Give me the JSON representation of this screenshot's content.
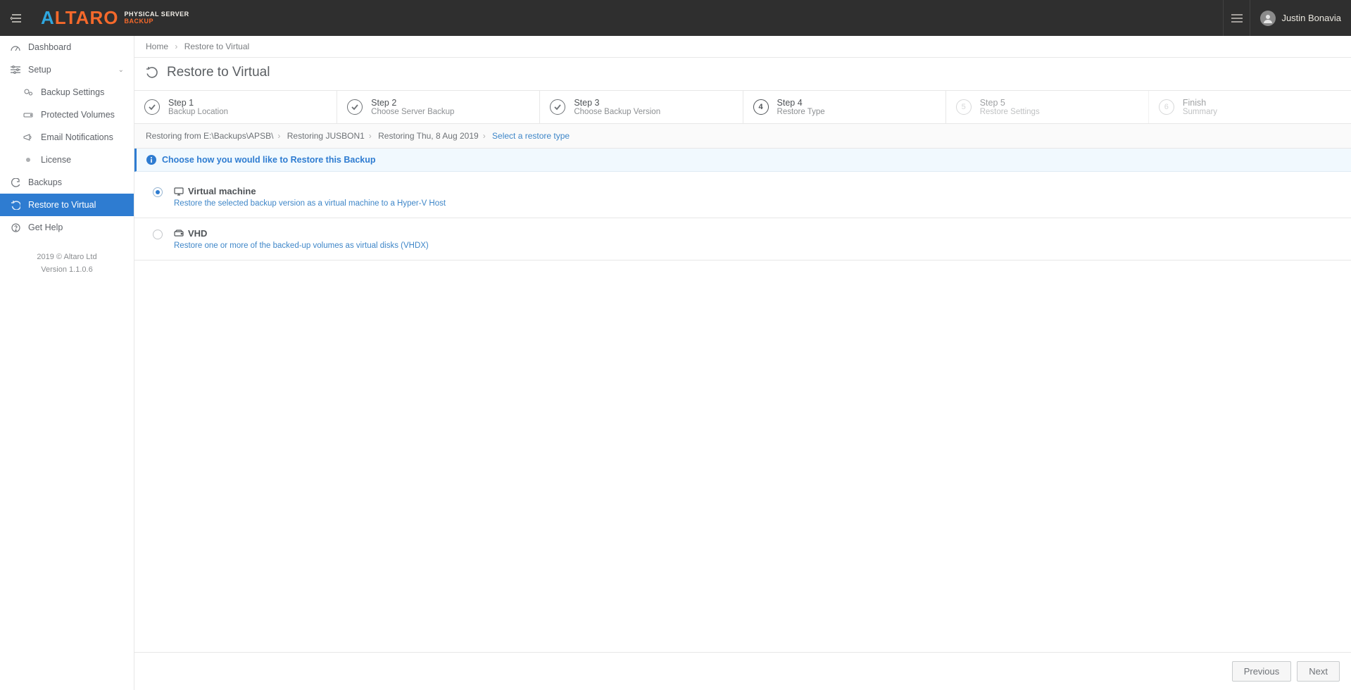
{
  "header": {
    "product_line1": "PHYSICAL SERVER",
    "product_line2": "BACKUP",
    "user_name": "Justin Bonavia"
  },
  "sidebar": {
    "dashboard": "Dashboard",
    "setup": "Setup",
    "backup_settings": "Backup Settings",
    "protected_volumes": "Protected Volumes",
    "email_notifications": "Email Notifications",
    "license": "License",
    "backups": "Backups",
    "restore_to_virtual": "Restore to Virtual",
    "get_help": "Get Help",
    "footer_line1": "2019 © Altaro Ltd",
    "footer_line2": "Version 1.1.0.6"
  },
  "breadcrumb": {
    "home": "Home",
    "current": "Restore to Virtual"
  },
  "page_title": "Restore to Virtual",
  "steps": [
    {
      "num": "✓",
      "title": "Step 1",
      "sub": "Backup Location",
      "state": "done"
    },
    {
      "num": "✓",
      "title": "Step 2",
      "sub": "Choose Server Backup",
      "state": "done"
    },
    {
      "num": "✓",
      "title": "Step 3",
      "sub": "Choose Backup Version",
      "state": "done"
    },
    {
      "num": "4",
      "title": "Step 4",
      "sub": "Restore Type",
      "state": "current"
    },
    {
      "num": "5",
      "title": "Step 5",
      "sub": "Restore Settings",
      "state": "future"
    },
    {
      "num": "6",
      "title": "Finish",
      "sub": "Summary",
      "state": "future"
    }
  ],
  "wiz_crumb": {
    "p1": "Restoring from E:\\Backups\\APSB\\",
    "p2": "Restoring JUSBON1",
    "p3": "Restoring Thu, 8 Aug 2019",
    "p4": "Select a restore type"
  },
  "info_text": "Choose how you would like to Restore this Backup",
  "options": [
    {
      "title": "Virtual machine",
      "desc": "Restore the selected backup version as a virtual machine to a Hyper-V Host",
      "checked": true,
      "icon": "monitor"
    },
    {
      "title": "VHD",
      "desc": "Restore one or more of the backed-up volumes as virtual disks (VHDX)",
      "checked": false,
      "icon": "disk"
    }
  ],
  "buttons": {
    "prev": "Previous",
    "next": "Next"
  }
}
